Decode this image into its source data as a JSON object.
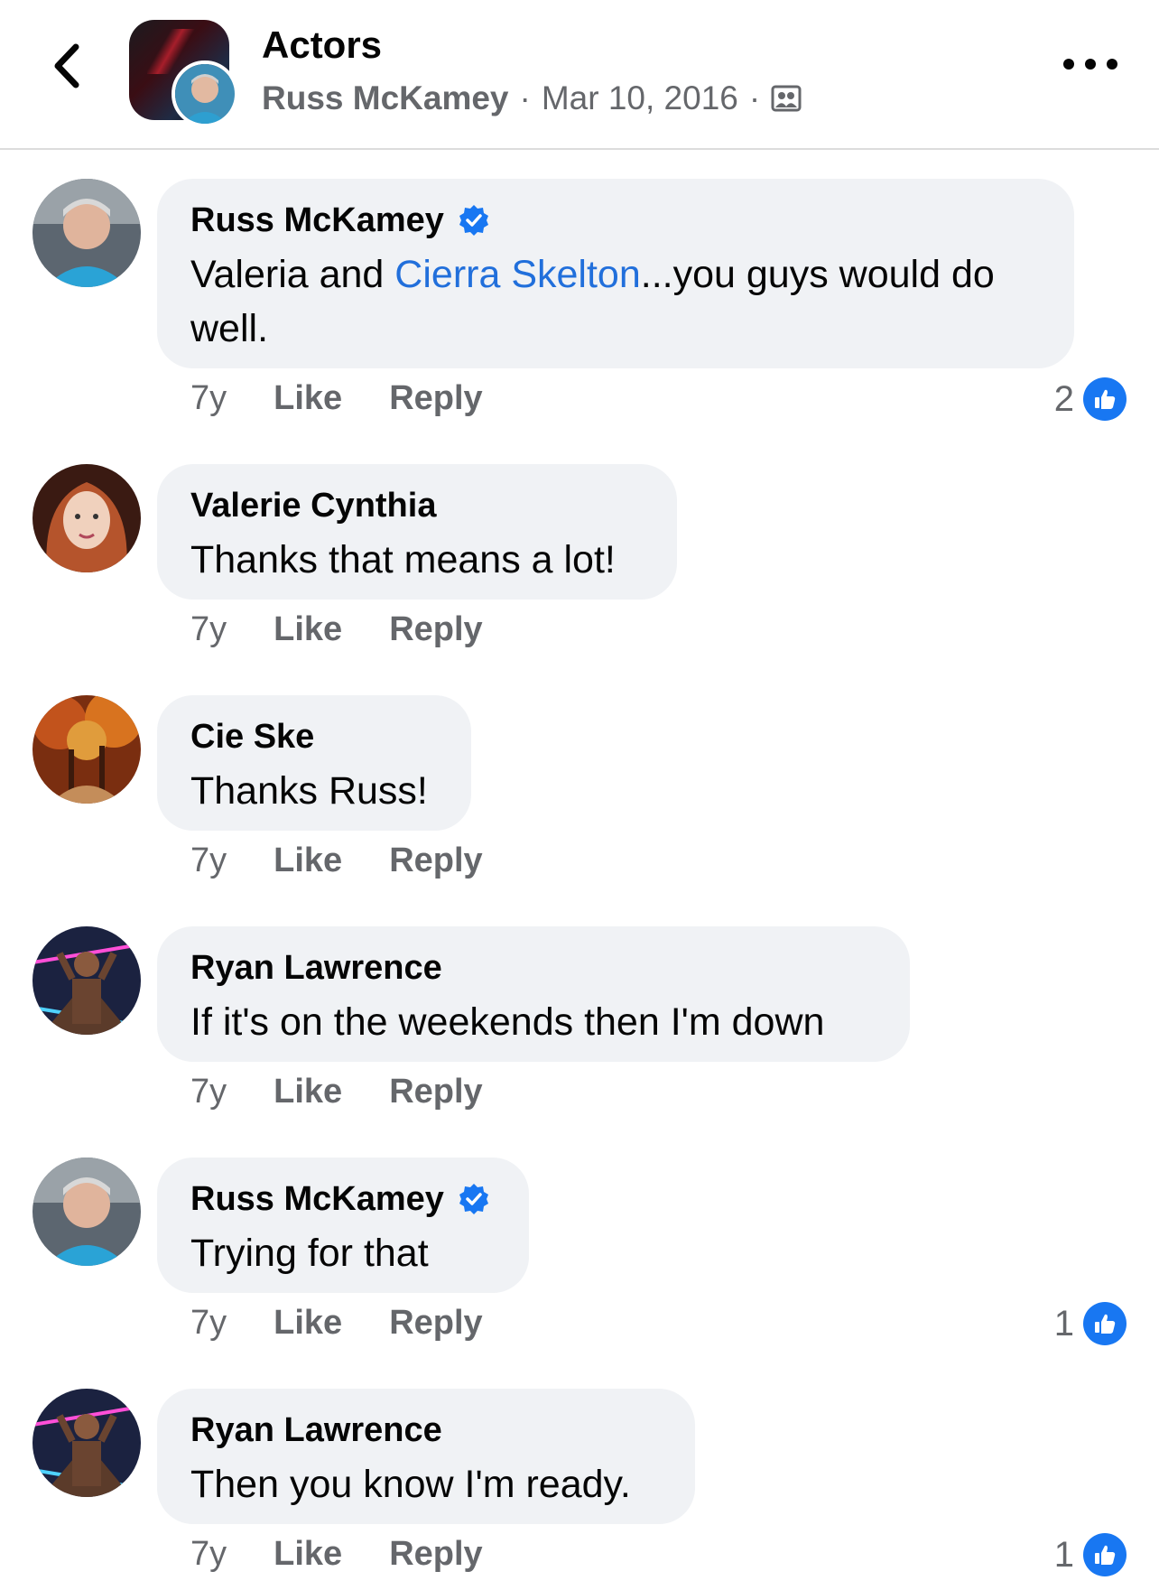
{
  "header": {
    "title": "Actors",
    "author": "Russ McKamey",
    "date": "Mar 10, 2016",
    "separator": "·",
    "privacy_icon": "group-privacy-icon"
  },
  "comments": [
    {
      "author": "Russ McKamey",
      "verified": true,
      "text_before": "Valeria and ",
      "mention": "Cierra Skelton",
      "text_after": "...you guys would do well.",
      "time": "7y",
      "like": "Like",
      "reply": "Reply",
      "reactions": "2"
    },
    {
      "author": "Valerie Cynthia",
      "verified": false,
      "text": "Thanks that means a lot!",
      "time": "7y",
      "like": "Like",
      "reply": "Reply"
    },
    {
      "author": "Cie Ske",
      "verified": false,
      "text": "Thanks Russ!",
      "time": "7y",
      "like": "Like",
      "reply": "Reply"
    },
    {
      "author": "Ryan Lawrence",
      "verified": false,
      "text": "If it's on the weekends then I'm down",
      "time": "7y",
      "like": "Like",
      "reply": "Reply"
    },
    {
      "author": "Russ McKamey",
      "verified": true,
      "text": "Trying for that",
      "time": "7y",
      "like": "Like",
      "reply": "Reply",
      "reactions": "1"
    },
    {
      "author": "Ryan Lawrence",
      "verified": false,
      "text": "Then you know I'm ready.",
      "time": "7y",
      "like": "Like",
      "reply": "Reply",
      "reactions": "1"
    }
  ],
  "colors": {
    "accent": "#1877f2",
    "mention": "#216fdb",
    "bubble": "#f0f2f5",
    "secondary_text": "#65676b"
  }
}
